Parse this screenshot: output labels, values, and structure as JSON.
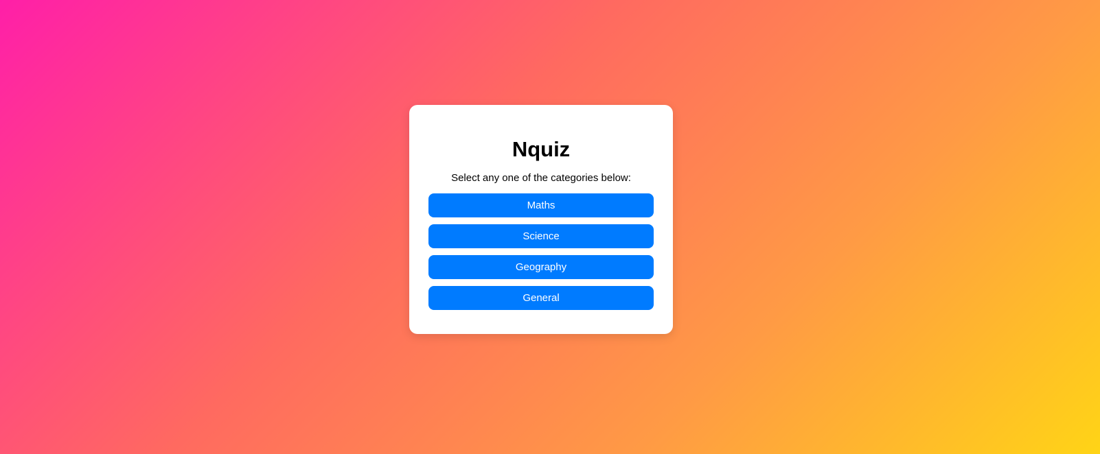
{
  "quiz": {
    "title": "Nquiz",
    "subtitle": "Select any one of the categories below:",
    "categories": [
      {
        "label": "Maths"
      },
      {
        "label": "Science"
      },
      {
        "label": "Geography"
      },
      {
        "label": "General"
      }
    ]
  },
  "colors": {
    "button": "#007bff",
    "button_text": "#ffffff",
    "card": "#ffffff",
    "gradient_start": "#ff1fa8",
    "gradient_end": "#ffd416"
  }
}
